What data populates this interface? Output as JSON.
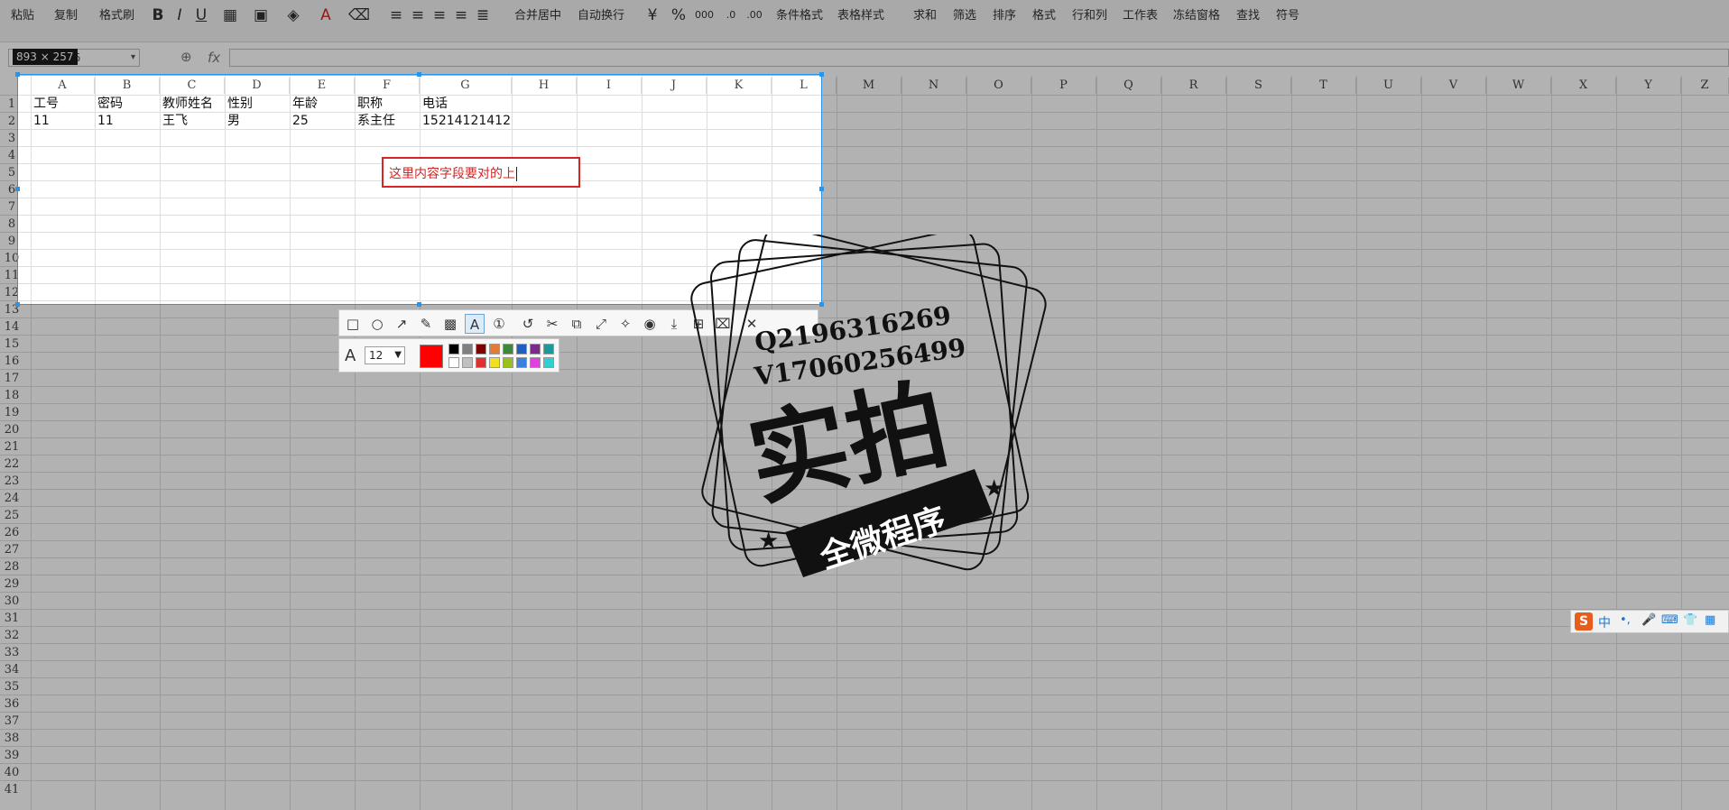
{
  "ribbon": {
    "items": [
      "粘贴",
      "复制",
      "格式刷",
      "合并居中",
      "自动换行",
      "条件格式",
      "表格样式",
      "求和",
      "筛选",
      "排序",
      "格式",
      "行和列",
      "工作表",
      "冻结窗格",
      "查找",
      "符号"
    ],
    "format_icons": [
      "B",
      "I",
      "U"
    ],
    "percent_icon": "%"
  },
  "formula_bar": {
    "size_badge": "893 × 257",
    "namebox_suffix": "5",
    "fx": "fx"
  },
  "columns": [
    "A",
    "B",
    "C",
    "D",
    "E",
    "F",
    "G",
    "H",
    "I",
    "J",
    "K",
    "L",
    "M",
    "N",
    "O",
    "P",
    "Q",
    "R",
    "S",
    "T",
    "U",
    "V",
    "W",
    "X",
    "Y",
    "Z"
  ],
  "rows": [
    "1",
    "2",
    "3",
    "4",
    "5",
    "6",
    "7",
    "8",
    "9",
    "10",
    "11",
    "12",
    "13",
    "14",
    "15",
    "16",
    "17",
    "18",
    "19",
    "20",
    "21",
    "22",
    "23",
    "24",
    "25",
    "26",
    "27",
    "28",
    "29",
    "30",
    "31",
    "32",
    "33",
    "34",
    "35",
    "36",
    "37",
    "38",
    "39",
    "40",
    "41"
  ],
  "table": {
    "headers": [
      "工号",
      "密码",
      "教师姓名",
      "性别",
      "年龄",
      "职称",
      "电话"
    ],
    "row1": [
      "11",
      "11",
      "王飞",
      "男",
      "25",
      "系主任",
      "15214121412"
    ]
  },
  "annotation": {
    "text": "这里内容字段要对的上"
  },
  "screenshot_toolbar": {
    "tools": [
      "rectangle-tool",
      "ellipse-tool",
      "arrow-tool",
      "pencil-tool",
      "mosaic-tool",
      "text-tool",
      "number-tool",
      "undo-tool",
      "crop-tool",
      "ocr-tool",
      "scroll-tool",
      "pin-tool",
      "record-tool",
      "save-tool",
      "copy-tool",
      "bookmark-tool",
      "close-tool"
    ],
    "font_size": "12",
    "current_color": "#ff0000",
    "palette_row1": [
      "#000000",
      "#808080",
      "#800000",
      "#e07b39",
      "#3a8a3a",
      "#1f5fbf",
      "#7a2a8a",
      "#1a9a9a"
    ],
    "palette_row2": [
      "#ffffff",
      "#c0c0c0",
      "#e03030",
      "#f0e020",
      "#9ac020",
      "#3a80e0",
      "#e040e0",
      "#30d0d0"
    ]
  },
  "watermark": {
    "line1": "Q2196316269",
    "line2": "V17060256499",
    "big": "实拍",
    "ribbon": "全微程序"
  },
  "ime": {
    "logo": "S",
    "lang": "中"
  }
}
